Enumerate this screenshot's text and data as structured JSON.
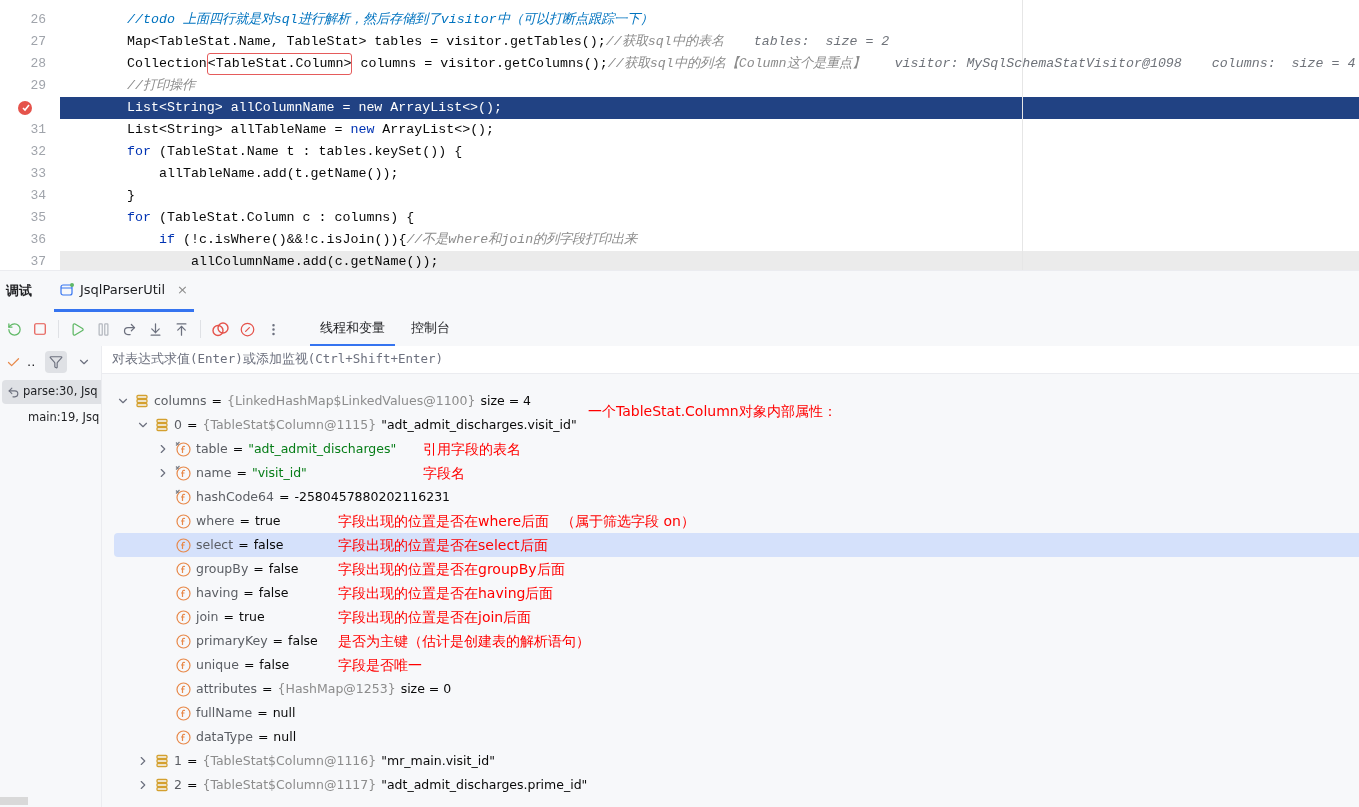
{
  "editor": {
    "lines": [
      {
        "number": "26",
        "current": false,
        "caret": false,
        "tokens": [
          {
            "text": "//todo 上面四行就是对sql进行解析，然后存储到了visitor中（可以打断点跟踪一下）",
            "kind": "todo"
          }
        ]
      },
      {
        "number": "27",
        "current": false,
        "caret": false,
        "tokens": [
          {
            "text": "Map<TableStat.Name, TableStat> tables = visitor.getTables();",
            "kind": "plain"
          },
          {
            "text": "//获取sql中的表名",
            "kind": "comment"
          },
          {
            "text": "tables:  size = 2",
            "kind": "hint"
          }
        ]
      },
      {
        "number": "28",
        "current": false,
        "caret": false,
        "tokens": [
          {
            "text": "Collection",
            "kind": "plain"
          },
          {
            "text": "<TableStat.Column>",
            "kind": "boxed"
          },
          {
            "text": " columns = visitor.getColumns();",
            "kind": "plain"
          },
          {
            "text": "//获取sql中的列名【Column这个是重点】",
            "kind": "comment"
          },
          {
            "text": "visitor: MySqlSchemaStatVisitor@1098",
            "kind": "hint"
          },
          {
            "text": "columns:  size = 4",
            "kind": "hint"
          }
        ]
      },
      {
        "number": "29",
        "current": false,
        "caret": false,
        "tokens": [
          {
            "text": "//打印操作",
            "kind": "comment"
          }
        ]
      },
      {
        "current": true,
        "caret": false,
        "breakpoint": true,
        "tokens": [
          {
            "text": "List<String> allColumnName = new ArrayList<>();",
            "kind": "plain"
          }
        ]
      },
      {
        "number": "31",
        "current": false,
        "caret": false,
        "tokens": [
          {
            "text": "List<String> allTableName = ",
            "kind": "plain"
          },
          {
            "text": "new",
            "kind": "keyword"
          },
          {
            "text": " ArrayList<>();",
            "kind": "plain"
          }
        ]
      },
      {
        "number": "32",
        "current": false,
        "caret": false,
        "tokens": [
          {
            "text": "for",
            "kind": "keyword"
          },
          {
            "text": " (TableStat.Name t : tables.keySet()) {",
            "kind": "plain"
          }
        ],
        "children": [
          {
            "number": "33",
            "current": false,
            "caret": false,
            "tokens": [
              {
                "text": "allTableName.add(t.getName());",
                "kind": "plain"
              }
            ]
          }
        ]
      },
      {
        "number": "34",
        "current": false,
        "caret": false,
        "tokens": [
          {
            "text": "}",
            "kind": "plain"
          }
        ]
      },
      {
        "number": "35",
        "current": false,
        "caret": false,
        "tokens": [
          {
            "text": "for",
            "kind": "keyword"
          },
          {
            "text": " (TableStat.Column c : columns) {",
            "kind": "plain"
          }
        ],
        "children": [
          {
            "number": "36",
            "current": false,
            "caret": false,
            "tokens": [
              {
                "text": "if",
                "kind": "keyword"
              },
              {
                "text": " (!c.isWhere()&&!c.isJoin()){",
                "kind": "plain"
              },
              {
                "text": "//不是where和join的列字段打印出来",
                "kind": "comment"
              }
            ],
            "children": [
              {
                "number": "37",
                "current": false,
                "caret": true,
                "tokens": [
                  {
                    "text": "allColumnName.add(c.getName());",
                    "kind": "plain"
                  }
                ]
              }
            ]
          }
        ]
      }
    ]
  },
  "debug": {
    "title": "调试",
    "session_tab": {
      "label": "JsqlParserUtil",
      "close": "×"
    },
    "view_tabs": [
      {
        "label": "线程和变量",
        "selected": true
      },
      {
        "label": "控制台",
        "selected": false
      }
    ],
    "frames_toolbar": {
      "check": "..",
      "filter_on": true
    },
    "frames": [
      {
        "label": "parse:30, Jsq",
        "selected": true,
        "kind": "return"
      },
      {
        "label": "main:19, Jsq",
        "selected": false,
        "kind": "plain"
      }
    ],
    "expression": {
      "placeholder": "对表达式求值(Enter)或添加监视(Ctrl+Shift+Enter)"
    },
    "variables": [
      {
        "kind": "list",
        "name": "columns",
        "expanded": true,
        "selected": false,
        "parts": [
          {
            "text": "=",
            "kind": "text"
          },
          {
            "text": "{LinkedHashMap$LinkedValues@1100}",
            "kind": "ref"
          },
          {
            "text": "size = 4",
            "kind": "text"
          }
        ],
        "notes": [
          {
            "text": "一个TableStat.Column对象内部属性：",
            "kind": "header"
          }
        ],
        "children": [
          {
            "kind": "list",
            "name": "0",
            "expanded": true,
            "selected": false,
            "parts": [
              {
                "text": "=",
                "kind": "text"
              },
              {
                "text": "{TableStat$Column@1115}",
                "kind": "ref"
              },
              {
                "text": "\"adt_admit_discharges.visit_id\"",
                "kind": "text"
              }
            ],
            "children": [
              {
                "kind": "final",
                "name": "table",
                "expanded": false,
                "selected": false,
                "parts": [
                  {
                    "text": "=",
                    "kind": "text"
                  },
                  {
                    "text": "\"adt_admit_discharges\"",
                    "kind": "string"
                  }
                ],
                "notes": [
                  {
                    "text": "引用字段的表名",
                    "kind": "far"
                  }
                ]
              },
              {
                "kind": "final",
                "name": "name",
                "expanded": false,
                "selected": false,
                "parts": [
                  {
                    "text": "=",
                    "kind": "text"
                  },
                  {
                    "text": "\"visit_id\"",
                    "kind": "string"
                  }
                ],
                "notes": [
                  {
                    "text": "字段名",
                    "kind": "far"
                  }
                ]
              },
              {
                "kind": "final",
                "name": "hashCode64",
                "selected": false,
                "parts": [
                  {
                    "text": "=",
                    "kind": "text"
                  },
                  {
                    "text": "-2580457880202116231",
                    "kind": "text"
                  }
                ]
              },
              {
                "kind": "field",
                "name": "where",
                "selected": false,
                "parts": [
                  {
                    "text": "=",
                    "kind": "text"
                  },
                  {
                    "text": "true",
                    "kind": "text"
                  }
                ],
                "notes": [
                  {
                    "text": "字段出现的位置是否在where后面",
                    "kind": "near"
                  },
                  {
                    "text": "（属于筛选字段 on）",
                    "kind": "aside"
                  }
                ]
              },
              {
                "kind": "field",
                "name": "select",
                "selected": true,
                "parts": [
                  {
                    "text": "=",
                    "kind": "text"
                  },
                  {
                    "text": "false",
                    "kind": "text"
                  }
                ],
                "notes": [
                  {
                    "text": "字段出现的位置是否在select后面",
                    "kind": "near"
                  }
                ]
              },
              {
                "kind": "field",
                "name": "groupBy",
                "selected": false,
                "parts": [
                  {
                    "text": "=",
                    "kind": "text"
                  },
                  {
                    "text": "false",
                    "kind": "text"
                  }
                ],
                "notes": [
                  {
                    "text": "字段出现的位置是否在groupBy后面",
                    "kind": "near"
                  }
                ]
              },
              {
                "kind": "field",
                "name": "having",
                "selected": false,
                "parts": [
                  {
                    "text": "=",
                    "kind": "text"
                  },
                  {
                    "text": "false",
                    "kind": "text"
                  }
                ],
                "notes": [
                  {
                    "text": "字段出现的位置是否在having后面",
                    "kind": "near"
                  }
                ]
              },
              {
                "kind": "field",
                "name": "join",
                "selected": false,
                "parts": [
                  {
                    "text": "=",
                    "kind": "text"
                  },
                  {
                    "text": "true",
                    "kind": "text"
                  }
                ],
                "notes": [
                  {
                    "text": "字段出现的位置是否在join后面",
                    "kind": "near"
                  }
                ]
              },
              {
                "kind": "field",
                "name": "primaryKey",
                "selected": false,
                "parts": [
                  {
                    "text": "=",
                    "kind": "text"
                  },
                  {
                    "text": "false",
                    "kind": "text"
                  }
                ],
                "notes": [
                  {
                    "text": "是否为主键（估计是创建表的解析语句）",
                    "kind": "near"
                  }
                ]
              },
              {
                "kind": "field",
                "name": "unique",
                "selected": false,
                "parts": [
                  {
                    "text": "=",
                    "kind": "text"
                  },
                  {
                    "text": "false",
                    "kind": "text"
                  }
                ],
                "notes": [
                  {
                    "text": "字段是否唯一",
                    "kind": "near"
                  }
                ]
              },
              {
                "kind": "field",
                "name": "attributes",
                "selected": false,
                "parts": [
                  {
                    "text": "=",
                    "kind": "text"
                  },
                  {
                    "text": "{HashMap@1253}",
                    "kind": "ref"
                  },
                  {
                    "text": "size = 0",
                    "kind": "text"
                  }
                ]
              },
              {
                "kind": "field",
                "name": "fullName",
                "selected": false,
                "parts": [
                  {
                    "text": "=",
                    "kind": "text"
                  },
                  {
                    "text": "null",
                    "kind": "text"
                  }
                ]
              },
              {
                "kind": "field",
                "name": "dataType",
                "selected": false,
                "parts": [
                  {
                    "text": "=",
                    "kind": "text"
                  },
                  {
                    "text": "null",
                    "kind": "text"
                  }
                ]
              }
            ]
          },
          {
            "kind": "list",
            "name": "1",
            "expanded": false,
            "selected": false,
            "parts": [
              {
                "text": "=",
                "kind": "text"
              },
              {
                "text": "{TableStat$Column@1116}",
                "kind": "ref"
              },
              {
                "text": "\"mr_main.visit_id\"",
                "kind": "text"
              }
            ]
          },
          {
            "kind": "list",
            "name": "2",
            "expanded": false,
            "selected": false,
            "parts": [
              {
                "text": "=",
                "kind": "text"
              },
              {
                "text": "{TableStat$Column@1117}",
                "kind": "ref"
              },
              {
                "text": "\"adt_admit_discharges.prime_id\"",
                "kind": "text"
              }
            ]
          }
        ]
      }
    ]
  }
}
